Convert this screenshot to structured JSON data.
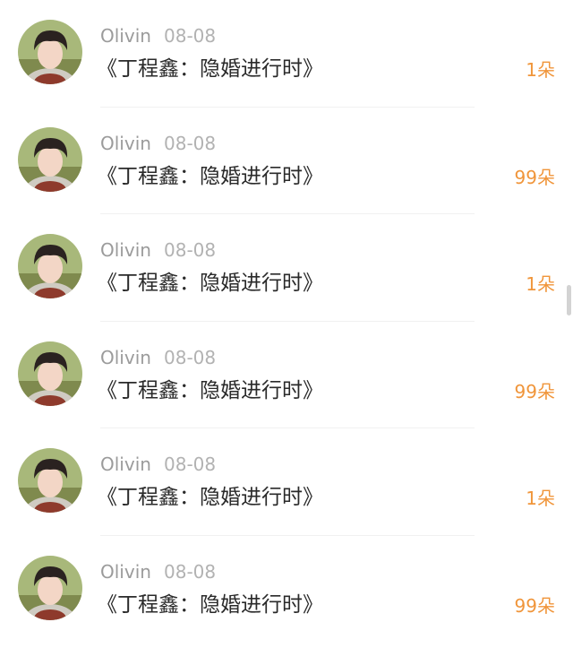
{
  "colors": {
    "name": "#9b9b9b",
    "date": "#b2b2b2",
    "title": "#2a2a2a",
    "count": "#f0953a",
    "divider": "#f1f1f1"
  },
  "items": [
    {
      "avatar": "user-avatar-photo",
      "name": "Olivin",
      "date": "08-08",
      "title": "《丁程鑫：隐婚进行时》",
      "count": "1朵"
    },
    {
      "avatar": "user-avatar-photo",
      "name": "Olivin",
      "date": "08-08",
      "title": "《丁程鑫：隐婚进行时》",
      "count": "99朵"
    },
    {
      "avatar": "user-avatar-photo",
      "name": "Olivin",
      "date": "08-08",
      "title": "《丁程鑫：隐婚进行时》",
      "count": "1朵"
    },
    {
      "avatar": "user-avatar-photo",
      "name": "Olivin",
      "date": "08-08",
      "title": "《丁程鑫：隐婚进行时》",
      "count": "99朵"
    },
    {
      "avatar": "user-avatar-photo",
      "name": "Olivin",
      "date": "08-08",
      "title": "《丁程鑫：隐婚进行时》",
      "count": "1朵"
    },
    {
      "avatar": "user-avatar-photo",
      "name": "Olivin",
      "date": "08-08",
      "title": "《丁程鑫：隐婚进行时》",
      "count": "99朵"
    }
  ]
}
